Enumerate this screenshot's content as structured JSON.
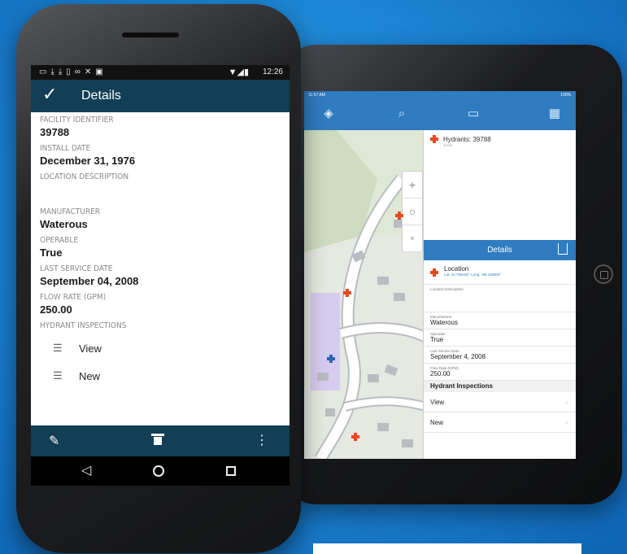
{
  "android": {
    "status_bar": {
      "time": "12:26"
    },
    "app_bar": {
      "title": "Details"
    },
    "fields": [
      {
        "label": "FACILITY IDENTIFIER",
        "value": "39788"
      },
      {
        "label": "INSTALL DATE",
        "value": "December 31, 1976"
      },
      {
        "label": "LOCATION DESCRIPTION",
        "value": ""
      },
      {
        "label": "MANUFACTURER",
        "value": "Waterous"
      },
      {
        "label": "OPERABLE",
        "value": "True"
      },
      {
        "label": "LAST SERVICE DATE",
        "value": "September 04, 2008"
      },
      {
        "label": "FLOW RATE (GPM)",
        "value": "250.00"
      }
    ],
    "inspections": {
      "label": "HYDRANT INSPECTIONS",
      "view_label": "View",
      "new_label": "New"
    }
  },
  "ipad": {
    "status_bar": {
      "time": "11:57 AM",
      "battery": "100%"
    },
    "popup": {
      "title": "Hydrants: 39788",
      "subtitle": "39788"
    },
    "details_header": "Details",
    "location": {
      "title": "Location",
      "coords": "Lat: 41.786180° Long: -88.125000°"
    },
    "location_description_label": "Location Description",
    "fields": [
      {
        "label": "Manufacturer",
        "value": "Waterous"
      },
      {
        "label": "Operable",
        "value": "True"
      },
      {
        "label": "Last Service Date",
        "value": "September 4, 2008"
      },
      {
        "label": "Flow Rate (GPM)",
        "value": "250.00"
      }
    ],
    "inspections_header": "Hydrant Inspections",
    "view_label": "View",
    "new_label": "New"
  },
  "colors": {
    "background": "#1c86d6",
    "android_bar": "#123e56",
    "ios_bar": "#2f7cc0",
    "hydrant": "#e34a1b"
  }
}
